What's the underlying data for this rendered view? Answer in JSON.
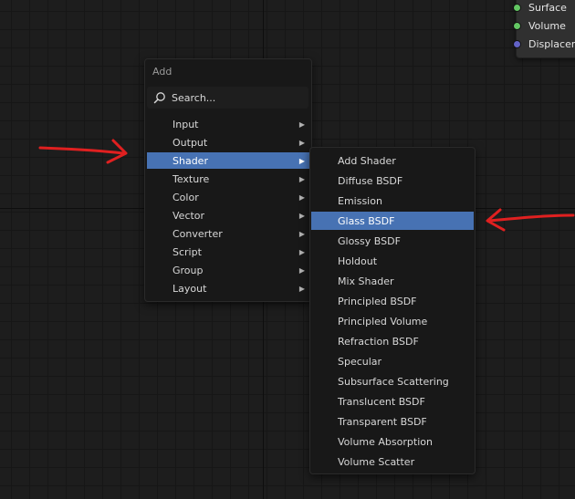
{
  "colors": {
    "accent": "#4772b3",
    "annotation": "#e02020",
    "socket_green": "#63c763",
    "socket_purple": "#6363c7"
  },
  "node_outputs": [
    {
      "label": "Surface",
      "socket": "green"
    },
    {
      "label": "Volume",
      "socket": "green"
    },
    {
      "label": "Displacem",
      "socket": "purple"
    }
  ],
  "add_menu": {
    "title": "Add",
    "search_label": "Search...",
    "items": [
      {
        "label": "Input",
        "submenu": true
      },
      {
        "label": "Output",
        "submenu": true
      },
      {
        "label": "Shader",
        "submenu": true,
        "active": true
      },
      {
        "label": "Texture",
        "submenu": true
      },
      {
        "label": "Color",
        "submenu": true
      },
      {
        "label": "Vector",
        "submenu": true
      },
      {
        "label": "Converter",
        "submenu": true
      },
      {
        "label": "Script",
        "submenu": true
      },
      {
        "label": "Group",
        "submenu": true
      },
      {
        "label": "Layout",
        "submenu": true
      }
    ]
  },
  "shader_menu": {
    "items": [
      {
        "label": "Add Shader"
      },
      {
        "label": "Diffuse BSDF"
      },
      {
        "label": "Emission"
      },
      {
        "label": "Glass BSDF",
        "active": true
      },
      {
        "label": "Glossy BSDF"
      },
      {
        "label": "Holdout"
      },
      {
        "label": "Mix Shader"
      },
      {
        "label": "Principled BSDF"
      },
      {
        "label": "Principled Volume"
      },
      {
        "label": "Refraction BSDF"
      },
      {
        "label": "Specular"
      },
      {
        "label": "Subsurface Scattering"
      },
      {
        "label": "Translucent BSDF"
      },
      {
        "label": "Transparent BSDF"
      },
      {
        "label": "Volume Absorption"
      },
      {
        "label": "Volume Scatter"
      }
    ]
  },
  "icons": {
    "search": "search-icon",
    "submenu_arrow": "chevron-right-icon"
  }
}
